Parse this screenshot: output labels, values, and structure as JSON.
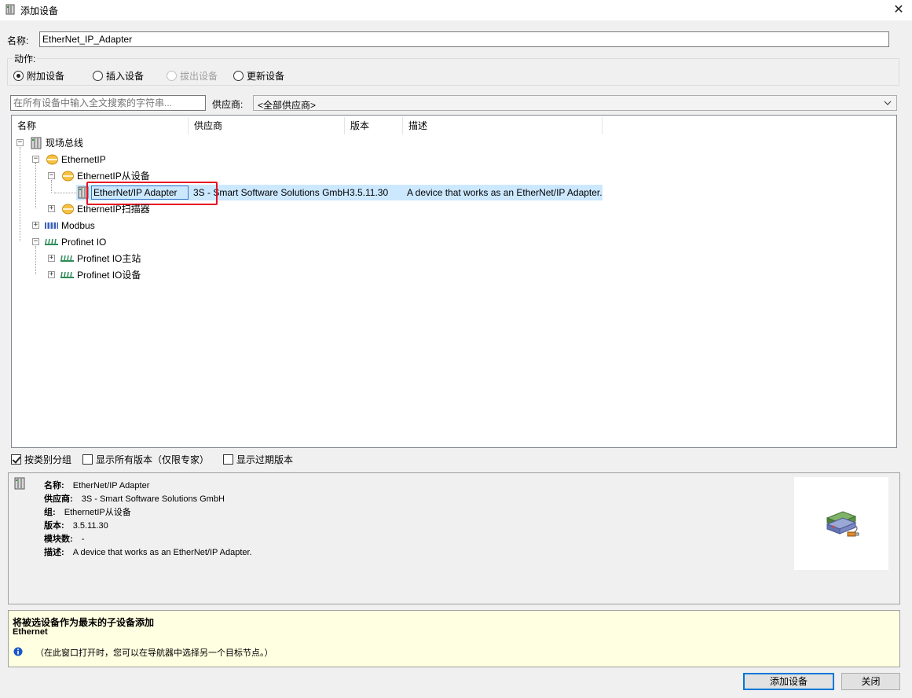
{
  "window": {
    "title": "添加设备",
    "icon": "device-module-icon",
    "close_glyph": "✕"
  },
  "name_row": {
    "label": "名称:",
    "value": "EtherNet_IP_Adapter"
  },
  "actions": {
    "legend": "动作:",
    "options": [
      {
        "label": "附加设备",
        "selected": true,
        "enabled": true
      },
      {
        "label": "插入设备",
        "selected": false,
        "enabled": true
      },
      {
        "label": "拔出设备",
        "selected": false,
        "enabled": false
      },
      {
        "label": "更新设备",
        "selected": false,
        "enabled": true
      }
    ]
  },
  "search": {
    "placeholder": "在所有设备中输入全文搜索的字符串...",
    "vendor_label": "供应商:",
    "vendor_value": "<全部供应商>"
  },
  "tree": {
    "columns": [
      "名称",
      "供应商",
      "版本",
      "描述"
    ],
    "nodes": [
      {
        "label": "现场总线",
        "icon": "fieldbus-icon",
        "expander": "−"
      },
      {
        "label": "EthernetIP",
        "icon": "ethernet-icon",
        "expander": "−"
      },
      {
        "label": "EthernetIP从设备",
        "icon": "ethernet-icon",
        "expander": "−"
      },
      {
        "label": "EtherNet/IP Adapter",
        "icon": "device-module-icon",
        "vendor": "3S - Smart Software Solutions GmbH",
        "version": "3.5.11.30",
        "description": "A device that works as an EtherNet/IP Adapter."
      },
      {
        "label": "EthernetIP扫描器",
        "icon": "ethernet-icon",
        "expander": "+"
      },
      {
        "label": "Modbus",
        "icon": "modbus-icon",
        "expander": "+"
      },
      {
        "label": "Profinet IO",
        "icon": "profinet-icon",
        "expander": "−"
      },
      {
        "label": "Profinet IO主站",
        "icon": "profinet-icon",
        "expander": "+"
      },
      {
        "label": "Profinet IO设备",
        "icon": "profinet-icon",
        "expander": "+"
      }
    ]
  },
  "options": {
    "group_by_category": {
      "label": "按类别分组",
      "checked": true
    },
    "show_all_versions": {
      "label": "显示所有版本（仅限专家）",
      "checked": false
    },
    "show_outdated": {
      "label": "显示过期版本",
      "checked": false
    }
  },
  "info": {
    "icon": "device-module-icon",
    "rows": [
      {
        "key": "名称:",
        "value": "EtherNet/IP Adapter"
      },
      {
        "key": "供应商:",
        "value": "3S - Smart Software Solutions GmbH"
      },
      {
        "key": "组:",
        "value": "EthernetIP从设备"
      },
      {
        "key": "版本:",
        "value": "3.5.11.30"
      },
      {
        "key": "模块数:",
        "value": "-"
      },
      {
        "key": "描述:",
        "value": "A device that works as an EtherNet/IP Adapter."
      }
    ],
    "image_icon": "network-device-illustration-icon"
  },
  "hint": {
    "title": "将被选设备作为最末的子设备添加",
    "subtitle": "Ethernet",
    "info_icon": "info-icon",
    "note": "（在此窗口打开时，您可以在导航器中选择另一个目标节点。）"
  },
  "buttons": {
    "add": "添加设备",
    "close": "关闭"
  },
  "colors": {
    "selection": "#cce8ff",
    "highlight_box": "#e81123",
    "hint_background": "#ffffe1",
    "accent": "#0078d7"
  }
}
